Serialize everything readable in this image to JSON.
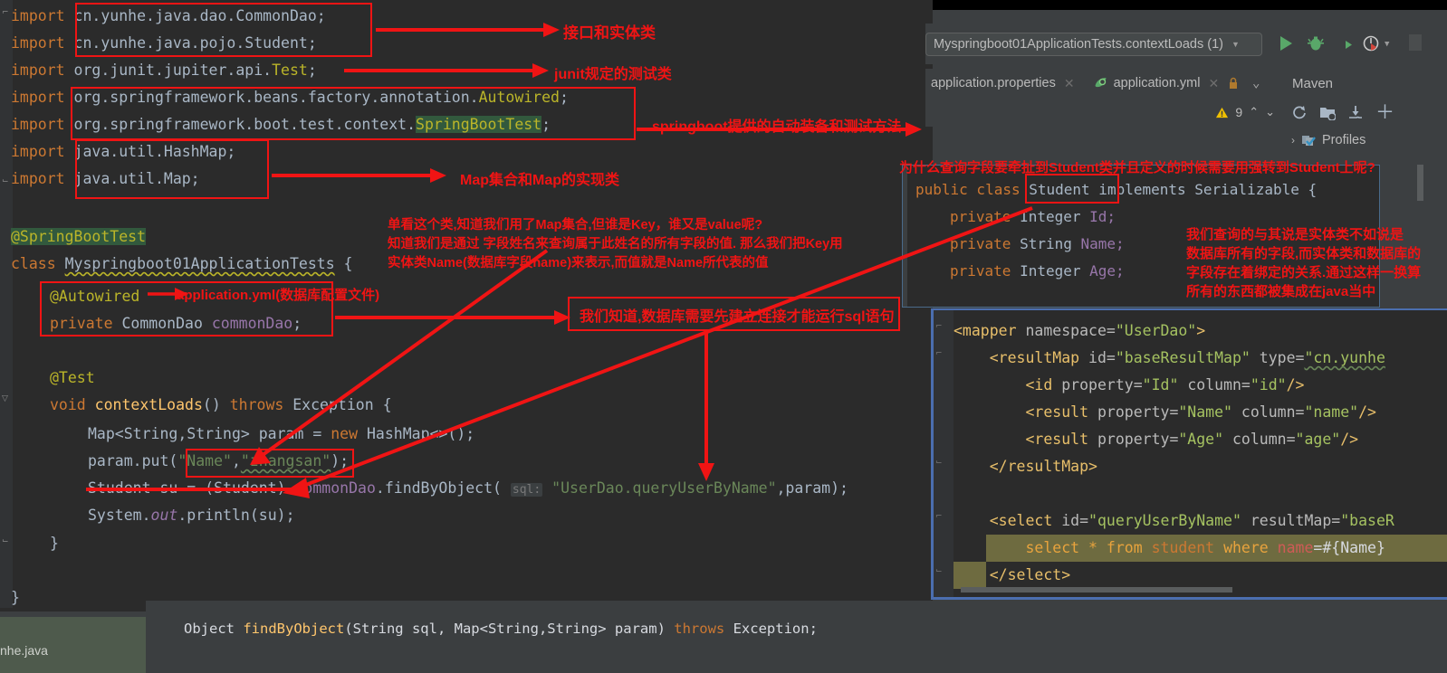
{
  "editor": {
    "language": "java",
    "imports": [
      {
        "kw": "import ",
        "pkg": "cn.yunhe.java.dao.CommonDao;"
      },
      {
        "kw": "import ",
        "pkg": "cn.yunhe.java.pojo.Student;"
      },
      {
        "kw": "import ",
        "pkg": "org.junit.jupiter.api.",
        "cls": "Test",
        "end": ";"
      },
      {
        "kw": "import ",
        "pkg": "org.springframework.beans.factory.annotation.",
        "cls": "Autowired",
        "end": ";"
      },
      {
        "kw": "import ",
        "pkg": "org.springframework.boot.test.context.",
        "cls": "SpringBootTest",
        "end": ";"
      },
      {
        "kw": "import ",
        "pkg": "java.util.HashMap;"
      },
      {
        "kw": "import ",
        "pkg": "java.util.Map;"
      }
    ],
    "code": {
      "annotation_springboottest": "@SpringBootTest",
      "class_line_kw": "class ",
      "class_name": "Myspringboot01ApplicationTests",
      "class_brace": " {",
      "annotation_autowired": "@Autowired",
      "field_modifier": "private ",
      "field_type": "CommonDao ",
      "field_name": "commonDao",
      "field_semi": ";",
      "annotation_test": "@Test",
      "method_kw_void": "void ",
      "method_name": "contextLoads",
      "method_parens": "() ",
      "method_throws": "throws ",
      "method_exception": "Exception {",
      "map_decl": "Map<String,String> param = ",
      "map_new": "new ",
      "map_hashmap": "HashMap<>();",
      "put_call": "param.put(",
      "put_key": "\"Name\"",
      "put_comma": ",",
      "put_value": "\"zhangsan\"",
      "put_end": ");",
      "student_decl": "Student su = (Student) ",
      "student_dao": "commonDao",
      "student_mth": ".findByObject( ",
      "student_hint": "sql:",
      "student_sql": " \"UserDao.queryUserByName\"",
      "student_param": ",param);",
      "println": "System.",
      "println_out": "out",
      "println_rest": ".println(su);",
      "close_brace_inner": "}",
      "close_brace_outer": "}"
    }
  },
  "run_toolbar": {
    "config_name": "Myspringboot01ApplicationTests.contextLoads (1)",
    "dropdown_caret": "▼",
    "buttons": [
      {
        "name": "run-button",
        "glyph": "▶",
        "color": "#59a869"
      },
      {
        "name": "debug-button",
        "glyph": "🐞",
        "color": "#6ea96e"
      },
      {
        "name": "run-with-coverage-button",
        "glyph": "◑",
        "color": "#a9b7c6"
      },
      {
        "name": "profiler-button",
        "glyph": "◔",
        "color": "#d0d0d0"
      }
    ]
  },
  "tabs": [
    {
      "label": "application.properties",
      "close": "✕",
      "icon": "properties-file-icon"
    },
    {
      "label": "application.yml",
      "close": "✕",
      "icon": "yaml-leaf-icon"
    }
  ],
  "tab_overflow": {
    "lock_icon": "lock-icon",
    "chevron": "⌄"
  },
  "warnings": {
    "icon": "warning-triangle-icon",
    "count": "9",
    "up": "⌃",
    "down": "⌄"
  },
  "maven": {
    "title": "Maven",
    "toolbar": [
      {
        "name": "reload-all-maven-projects-icon",
        "glyph": "⟳"
      },
      {
        "name": "add-maven-project-icon",
        "glyph": "🗀"
      },
      {
        "name": "download-sources-icon",
        "glyph": "⤓"
      },
      {
        "name": "add-icon",
        "glyph": "＋"
      }
    ],
    "tree": [
      {
        "expander": "›",
        "icon": "profiles-icon",
        "label": "Profiles"
      }
    ]
  },
  "student_class": {
    "lines": [
      {
        "kw": "public class ",
        "name": "Student",
        "impl": " implements Serializable {"
      },
      {
        "mod": "private ",
        "type": "Integer ",
        "field": "Id;"
      },
      {
        "mod": "private ",
        "type": "String ",
        "field": "Name;"
      },
      {
        "mod": "private ",
        "type": "Integer ",
        "field": "Age;"
      }
    ]
  },
  "mapper_xml": {
    "lines": [
      "<mapper namespace=\"UserDao\">",
      "    <resultMap id=\"baseResultMap\" type=\"cn.yunhe",
      "        <id property=\"Id\" column=\"id\"/>",
      "        <result property=\"Name\" column=\"name\"/>",
      "        <result property=\"Age\" column=\"age\"/>",
      "    </resultMap>",
      "",
      "    <select id=\"queryUserByName\" resultMap=\"baseR",
      "        select * from student where name=#{Name}",
      "    </select>"
    ]
  },
  "tooltip": {
    "ret": "Object ",
    "method": "findByObject",
    "params": "(String sql, Map<String,String> param) ",
    "throws": "throws ",
    "exception": "Exception;"
  },
  "status_file": {
    "label": "nhe.java"
  },
  "annotations": {
    "note_interface_entity": "接口和实体类",
    "note_junit": "junit规定的测试类",
    "note_springboot": "springboot提供的自动装备和测试方法",
    "note_map": "Map集合和Map的实现类",
    "note_yml": "application.yml(数据库配置文件)",
    "note_map_explain_1": "单看这个类,知道我们用了Map集合,但谁是Key，谁又是value呢?",
    "note_map_explain_2": "知道我们是通过 字段姓名来查询属于此姓名的所有字段的值. 那么我们把Key用",
    "note_map_explain_3": "实体类Name(数据库字段name)来表示,而值就是Name所代表的值",
    "note_db_conn": "我们知道,数据库需要先建立连接才能运行sql语句",
    "note_why_student": "为什么查询字段要牵扯到Student类并且定义的时候需要用强转到Student上呢?",
    "note_entity_1": "我们查询的与其说是实体类不如说是",
    "note_entity_2": "数据库所有的字段,而实体类和数据库的",
    "note_entity_3": "字段存在着绑定的关系.通过这样一换算",
    "note_entity_4": "所有的东西都被集成在java当中"
  },
  "colors": {
    "annotation_red": "#f01414",
    "editor_bg": "#2b2b2b",
    "chrome_bg": "#3c3f41",
    "keyword": "#cc7832",
    "string": "#6a8759",
    "annotation_yellow": "#bbb529",
    "field": "#9876aa",
    "method": "#ffc66d",
    "xml_tag": "#e8bf6a",
    "selection_blue": "#4b6eaf"
  }
}
